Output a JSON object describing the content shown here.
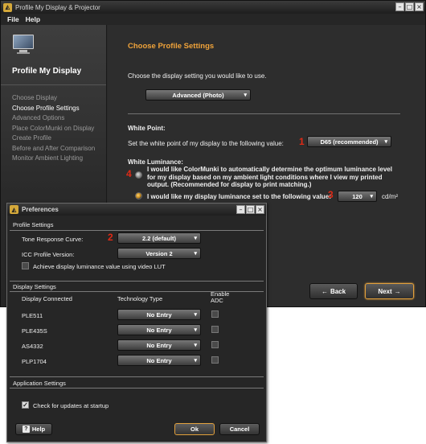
{
  "app": {
    "title": "Profile My Display & Projector",
    "menu": [
      "File",
      "Help"
    ]
  },
  "sidebar": {
    "heading": "Profile My Display",
    "steps": [
      "Choose Display",
      "Choose Profile Settings",
      "Advanced Options",
      "Place ColorMunki on Display",
      "Create Profile",
      "Before and After Comparison",
      "Monitor Ambient Lighting"
    ],
    "active_index": 1
  },
  "main": {
    "section_title": "Choose Profile Settings",
    "display_setting_prompt": "Choose the display setting you would like to use.",
    "display_setting_value": "Advanced (Photo)",
    "white_point": {
      "label": "White Point:",
      "prompt": "Set the white point of my display to the following value:",
      "marker": "1",
      "value": "D65 (recommended)"
    },
    "white_luminance": {
      "label": "White Luminance:",
      "marker": "4",
      "auto_option": "I would like ColorMunki to automatically determine the optimum luminance level for my display based on my ambient light conditions where I view my printed output. (Recommended for display to print matching.)",
      "manual_option": "I would like my display luminance set to the following value:",
      "marker_manual": "3",
      "value": "120",
      "unit": "cd/m²"
    },
    "back_label": "Back",
    "next_label": "Next"
  },
  "preferences": {
    "title": "Preferences",
    "profile_settings": {
      "heading": "Profile Settings",
      "trc_label": "Tone Response Curve:",
      "trc_marker": "2",
      "trc_value": "2.2 (default)",
      "icc_label": "ICC Profile Version:",
      "icc_value": "Version 2",
      "lut_label": "Achieve display luminance value using video LUT",
      "lut_checked": false
    },
    "display_settings": {
      "heading": "Display Settings",
      "col_display": "Display Connected",
      "col_tech": "Technology Type",
      "col_adc": "Enable ADC",
      "rows": [
        {
          "display": "PLE511",
          "tech": "No Entry",
          "adc": false
        },
        {
          "display": "PLE435S",
          "tech": "No Entry",
          "adc": false
        },
        {
          "display": "AS4332",
          "tech": "No Entry",
          "adc": false
        },
        {
          "display": "PLP1704",
          "tech": "No Entry",
          "adc": false
        }
      ]
    },
    "application_settings": {
      "heading": "Application Settings",
      "updates_label": "Check for updates at startup",
      "updates_checked": true
    },
    "help_label": "Help",
    "ok_label": "Ok",
    "cancel_label": "Cancel"
  }
}
